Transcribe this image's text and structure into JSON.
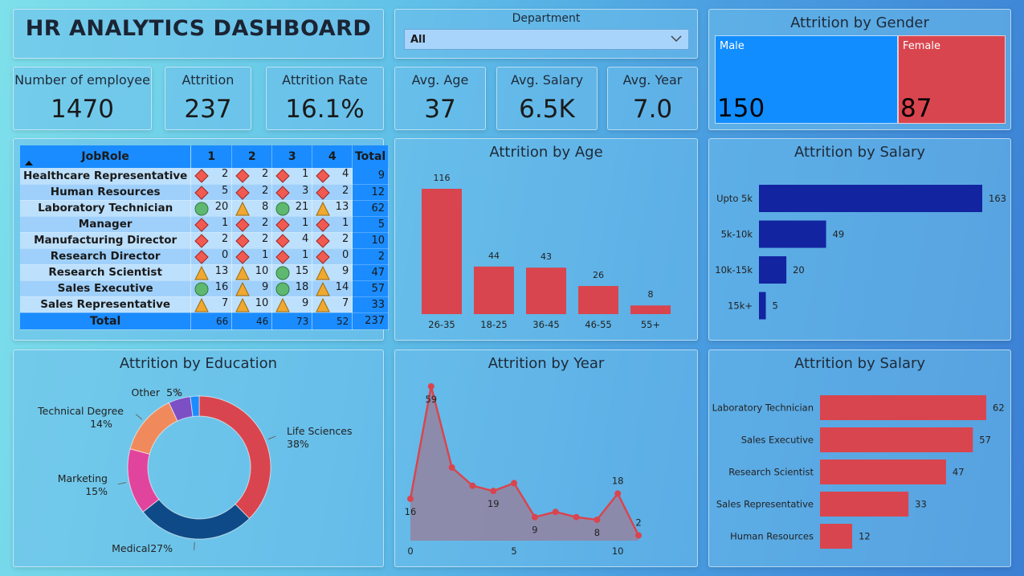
{
  "title": "HR ANALYTICS DASHBOARD",
  "slicer": {
    "label": "Department",
    "value": "All"
  },
  "kpis": [
    {
      "label": "Number of employee",
      "value": "1470"
    },
    {
      "label": "Attrition",
      "value": "237"
    },
    {
      "label": "Attrition Rate",
      "value": "16.1%"
    },
    {
      "label": "Avg. Age",
      "value": "37"
    },
    {
      "label": "Avg. Salary",
      "value": "6.5K"
    },
    {
      "label": "Avg. Year",
      "value": "7.0"
    }
  ],
  "gender": {
    "title": "Attrition by Gender",
    "items": [
      {
        "label": "Male",
        "value": "150",
        "color": "#118dff"
      },
      {
        "label": "Female",
        "value": "87",
        "color": "#d9454e"
      }
    ]
  },
  "matrix": {
    "headers": [
      "JobRole",
      "1",
      "2",
      "3",
      "4",
      "Total"
    ],
    "rows": [
      {
        "role": "Healthcare Representative",
        "vals": [
          2,
          2,
          1,
          4
        ],
        "icons": [
          "diamond",
          "diamond",
          "diamond",
          "diamond"
        ],
        "total": 9
      },
      {
        "role": "Human Resources",
        "vals": [
          5,
          2,
          3,
          2
        ],
        "icons": [
          "diamond",
          "diamond",
          "diamond",
          "diamond"
        ],
        "total": 12
      },
      {
        "role": "Laboratory Technician",
        "vals": [
          20,
          8,
          21,
          13
        ],
        "icons": [
          "circle",
          "triangle",
          "circle",
          "triangle"
        ],
        "total": 62
      },
      {
        "role": "Manager",
        "vals": [
          1,
          2,
          1,
          1
        ],
        "icons": [
          "diamond",
          "diamond",
          "diamond",
          "diamond"
        ],
        "total": 5
      },
      {
        "role": "Manufacturing Director",
        "vals": [
          2,
          2,
          4,
          2
        ],
        "icons": [
          "diamond",
          "diamond",
          "diamond",
          "diamond"
        ],
        "total": 10
      },
      {
        "role": "Research Director",
        "vals": [
          0,
          1,
          1,
          0
        ],
        "icons": [
          "diamond",
          "diamond",
          "diamond",
          "diamond"
        ],
        "total": 2
      },
      {
        "role": "Research Scientist",
        "vals": [
          13,
          10,
          15,
          9
        ],
        "icons": [
          "triangle",
          "triangle",
          "circle",
          "triangle"
        ],
        "total": 47
      },
      {
        "role": "Sales Executive",
        "vals": [
          16,
          9,
          18,
          14
        ],
        "icons": [
          "circle",
          "triangle",
          "circle",
          "triangle"
        ],
        "total": 57
      },
      {
        "role": "Sales Representative",
        "vals": [
          7,
          10,
          9,
          7
        ],
        "icons": [
          "triangle",
          "triangle",
          "triangle",
          "triangle"
        ],
        "total": 33
      }
    ],
    "total_row": {
      "label": "Total",
      "vals": [
        66,
        46,
        73,
        52
      ],
      "total": 237
    },
    "icon_colors": {
      "diamond": "#f05a50",
      "triangle": "#f0a830",
      "circle": "#5fb870"
    }
  },
  "chart_data": [
    {
      "id": "age",
      "type": "bar",
      "title": "Attrition by Age",
      "categories": [
        "26-35",
        "18-25",
        "36-45",
        "46-55",
        "55+"
      ],
      "values": [
        116,
        44,
        43,
        26,
        8
      ],
      "color": "#d9454e"
    },
    {
      "id": "salary",
      "type": "bar",
      "orientation": "horizontal",
      "title": "Attrition by Salary",
      "categories": [
        "Upto 5k",
        "5k-10k",
        "10k-15k",
        "15k+"
      ],
      "values": [
        163,
        49,
        20,
        5
      ],
      "color": "#1224a0"
    },
    {
      "id": "education",
      "type": "pie",
      "title": "Attrition by Education",
      "slices": [
        {
          "label": "Life Sciences",
          "pct_label": "38%",
          "value": 38,
          "color": "#d9454e"
        },
        {
          "label": "Medical",
          "pct_label": "27%",
          "value": 27,
          "color": "#0e4a87"
        },
        {
          "label": "Marketing",
          "pct_label": "15%",
          "value": 15,
          "color": "#e0449c"
        },
        {
          "label": "Technical Degree",
          "pct_label": "14%",
          "value": 14,
          "color": "#f08a5c"
        },
        {
          "label": "Other",
          "pct_label": "5%",
          "value": 5,
          "color": "#7c4fc4"
        },
        {
          "label": "",
          "pct_label": "",
          "value": 2,
          "color": "#1a8cff"
        }
      ]
    },
    {
      "id": "year",
      "type": "area",
      "title": "Attrition by Year",
      "x": [
        0,
        1,
        2,
        3,
        4,
        5,
        6,
        7,
        8,
        9,
        10,
        11
      ],
      "values": [
        16,
        59,
        28,
        21,
        19,
        22,
        9,
        11,
        9,
        8,
        18,
        2
      ],
      "labeled_points": [
        0,
        1,
        4,
        6,
        9,
        10,
        11
      ],
      "x_ticks": [
        0,
        5,
        10
      ],
      "color": "#d9454e",
      "fill": "#8e88a8"
    },
    {
      "id": "salary2",
      "type": "bar",
      "orientation": "horizontal",
      "title": "Attrition by Salary",
      "categories": [
        "Laboratory Technician",
        "Sales Executive",
        "Research Scientist",
        "Sales Representative",
        "Human Resources"
      ],
      "values": [
        62,
        57,
        47,
        33,
        12
      ],
      "color": "#d9454e"
    }
  ]
}
